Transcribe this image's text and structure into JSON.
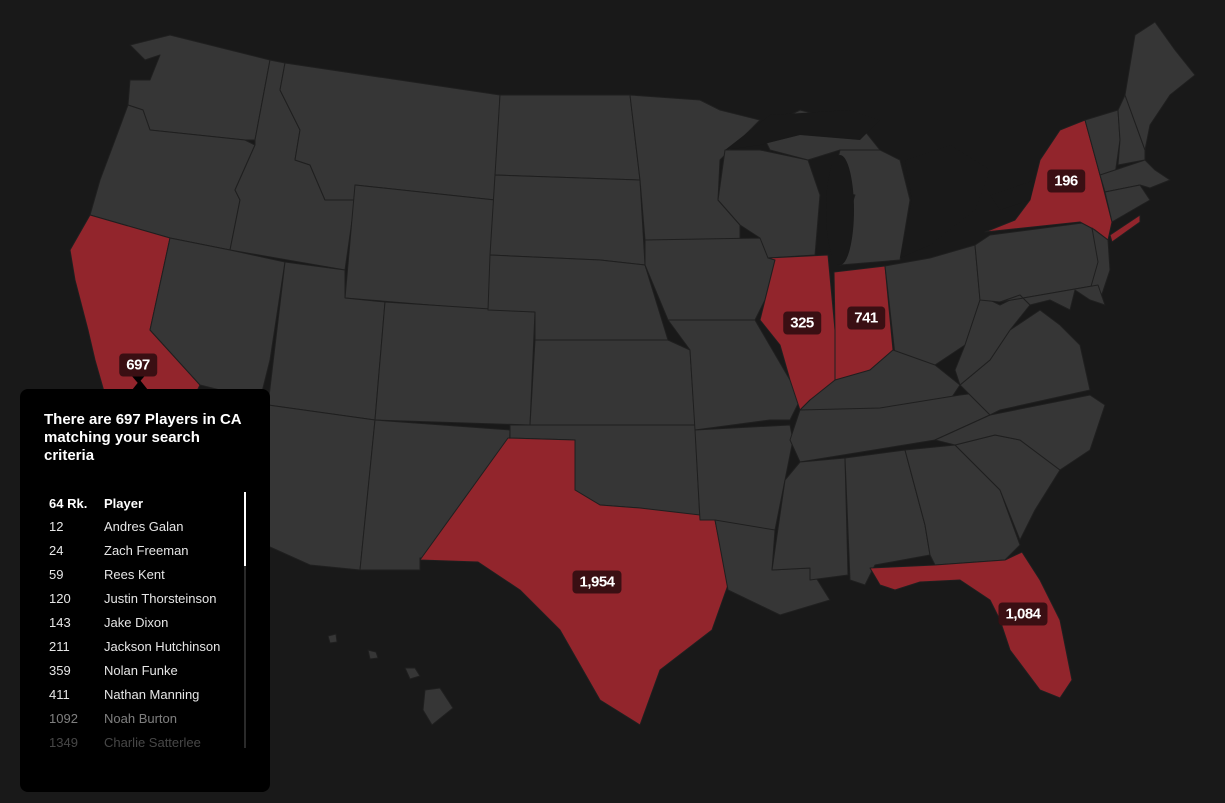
{
  "map": {
    "highlight_color": "#92252c",
    "base_color": "#363636",
    "background_color": "#191919",
    "label_bg_color": "#3a0f13",
    "highlighted_states": [
      {
        "code": "CA",
        "name": "California",
        "count": "697",
        "active": true
      },
      {
        "code": "TX",
        "name": "Texas",
        "count": "1,954",
        "active": false
      },
      {
        "code": "IL",
        "name": "Illinois",
        "count": "325",
        "active": false
      },
      {
        "code": "IN",
        "name": "Indiana",
        "count": "741",
        "active": false
      },
      {
        "code": "NY",
        "name": "New York",
        "count": "196",
        "active": false
      },
      {
        "code": "FL",
        "name": "Florida",
        "count": "1,084",
        "active": false
      }
    ]
  },
  "popup": {
    "title": "There are 697 Players in CA matching your search criteria",
    "columns": [
      "64 Rk.",
      "Player"
    ],
    "rows": [
      {
        "rank": "12",
        "player": "Andres Galan"
      },
      {
        "rank": "24",
        "player": "Zach Freeman"
      },
      {
        "rank": "59",
        "player": "Rees Kent"
      },
      {
        "rank": "120",
        "player": "Justin Thorsteinson"
      },
      {
        "rank": "143",
        "player": "Jake Dixon"
      },
      {
        "rank": "211",
        "player": "Jackson Hutchinson"
      },
      {
        "rank": "359",
        "player": "Nolan Funke"
      },
      {
        "rank": "411",
        "player": "Nathan Manning"
      },
      {
        "rank": "1092",
        "player": "Noah Burton"
      },
      {
        "rank": "1349",
        "player": "Charlie Satterlee"
      }
    ]
  }
}
